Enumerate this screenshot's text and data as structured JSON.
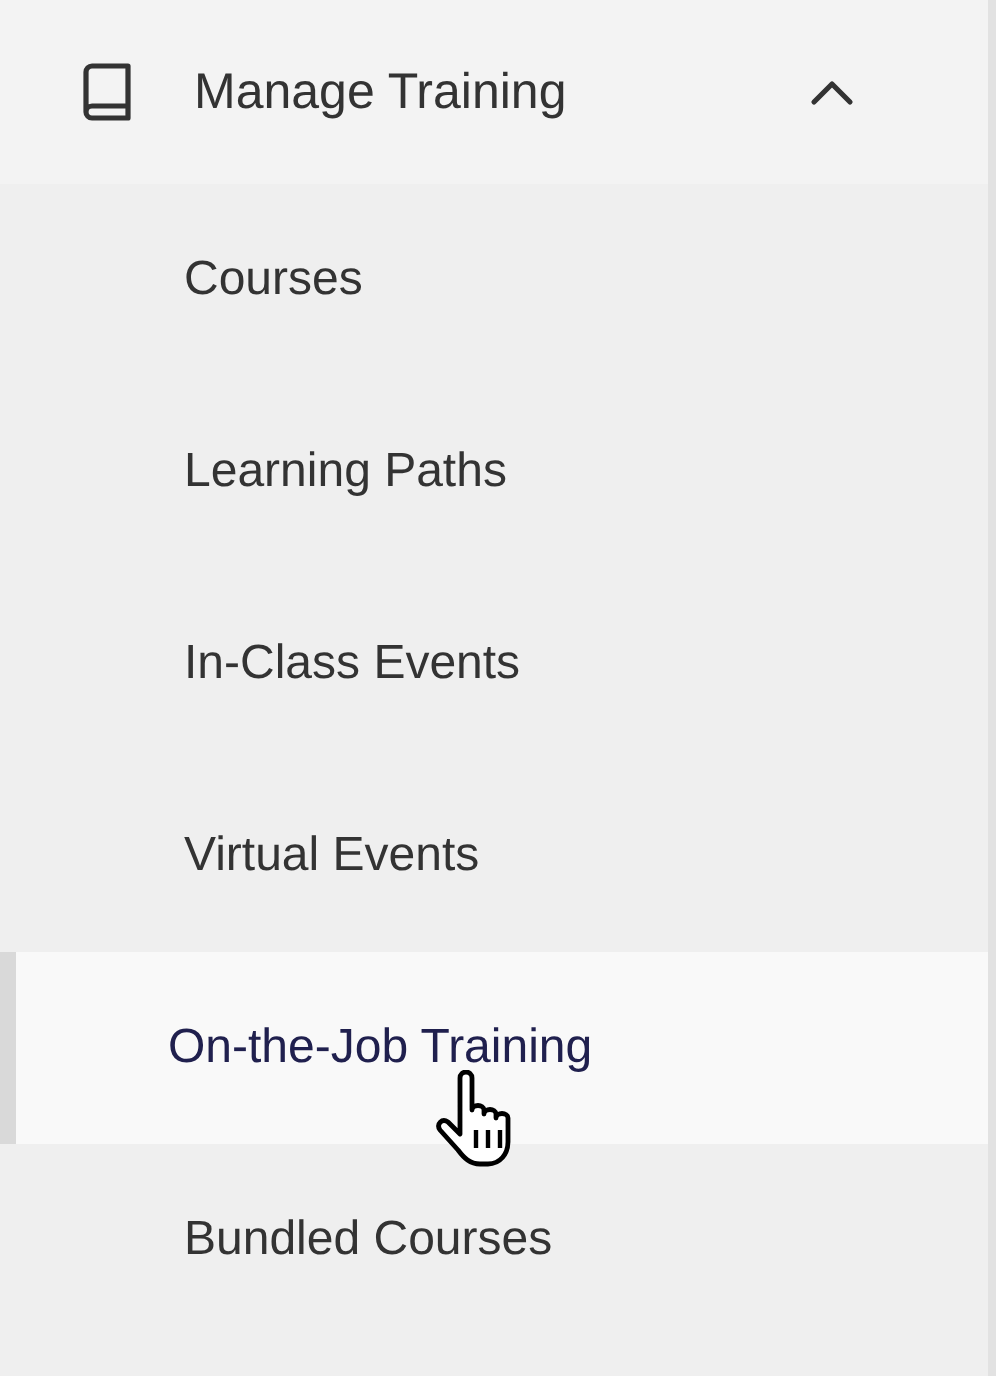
{
  "section": {
    "title": "Manage Training",
    "expanded": true
  },
  "items": [
    {
      "label": "Courses",
      "selected": false
    },
    {
      "label": "Learning Paths",
      "selected": false
    },
    {
      "label": "In-Class Events",
      "selected": false
    },
    {
      "label": "Virtual Events",
      "selected": false
    },
    {
      "label": "On-the-Job Training",
      "selected": true
    },
    {
      "label": "Bundled Courses",
      "selected": false
    }
  ]
}
